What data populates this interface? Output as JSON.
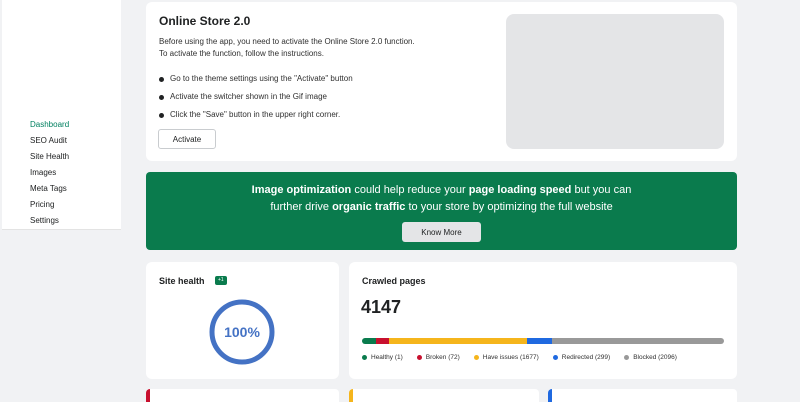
{
  "sidebar": {
    "items": [
      {
        "label": "Dashboard",
        "active": true
      },
      {
        "label": "SEO Audit"
      },
      {
        "label": "Site Health"
      },
      {
        "label": "Images"
      },
      {
        "label": "Meta Tags"
      },
      {
        "label": "Pricing"
      },
      {
        "label": "Settings"
      }
    ]
  },
  "onboarding": {
    "title": "Online Store 2.0",
    "intro_line1": "Before using the app, you need to activate the Online Store 2.0 function.",
    "intro_line2": "To activate the function, follow the instructions.",
    "steps": [
      "Go to the theme settings using the \"Activate\" button",
      "Activate the switcher shown in the Gif image",
      "Click the \"Save\" button in the upper right corner."
    ],
    "activate_label": "Activate"
  },
  "promo": {
    "l1_a": "Image optimization",
    "l1_b": " could help reduce your ",
    "l1_c": "page loading speed",
    "l1_d": " but you can",
    "l2_a": "further drive ",
    "l2_b": "organic traffic",
    "l2_c": " to your store by optimizing the full website",
    "button_label": "Know More",
    "bg_color": "#0a7b4d"
  },
  "site_health": {
    "title": "Site health",
    "badge": "+1",
    "value": "100%",
    "percent": 100,
    "ring_color": "#4472c4"
  },
  "crawled": {
    "title": "Crawled pages",
    "total": "4147",
    "segments": [
      {
        "label": "Healthy (1)",
        "count": 1,
        "color": "#0a7b4d"
      },
      {
        "label": "Broken (72)",
        "count": 72,
        "color": "#c8102e"
      },
      {
        "label": "Have issues (1677)",
        "count": 1677,
        "color": "#f5b51c"
      },
      {
        "label": "Redirected (299)",
        "count": 299,
        "color": "#1f69e0"
      },
      {
        "label": "Blocked (2096)",
        "count": 2096,
        "color": "#999999"
      }
    ]
  },
  "bottom_cards": [
    {
      "accent": "#c8102e"
    },
    {
      "accent": "#f5b51c"
    },
    {
      "accent": "#1f69e0"
    }
  ]
}
